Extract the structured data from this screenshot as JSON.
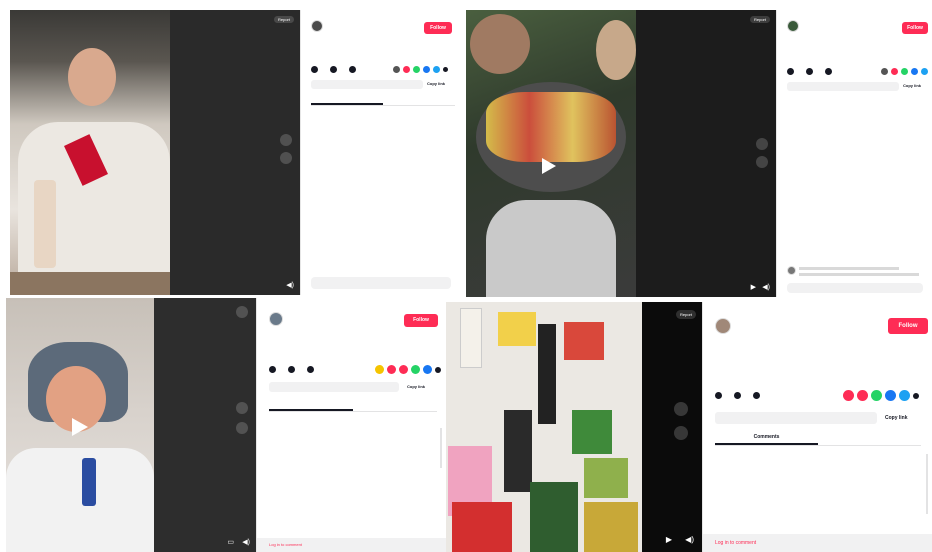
{
  "colors": {
    "accent": "#fe2c55",
    "text": "#161823",
    "muted": "#8a8b91",
    "dark_bg": "#262626"
  },
  "panels": [
    {
      "id": "p1",
      "username": "",
      "meta": "",
      "description": "",
      "music": "",
      "follow_label": "Follow",
      "stats": [
        "",
        "",
        ""
      ],
      "copy_link_label": "Copy link",
      "tabs": [
        "",
        ""
      ],
      "comment_placeholder": "",
      "video_caption": "",
      "report_label": "Report"
    },
    {
      "id": "p2",
      "username": "",
      "meta": "",
      "description": "",
      "music": "",
      "follow_label": "Follow",
      "stats": [
        "",
        "",
        ""
      ],
      "copy_link_label": "Copy link",
      "tabs": [],
      "comment_placeholder": "",
      "video_overlay": "",
      "report_label": "Report"
    },
    {
      "id": "p3",
      "username": "",
      "meta": "",
      "description": "",
      "music": "",
      "follow_label": "Follow",
      "stats": [
        "",
        "",
        ""
      ],
      "copy_link_label": "Copy link",
      "tabs": [
        "",
        ""
      ],
      "comment_placeholder": "Log in to comment"
    },
    {
      "id": "p4",
      "username": "",
      "meta": "",
      "description": "",
      "music": "",
      "follow_label": "Follow",
      "stats": [
        "",
        "",
        ""
      ],
      "copy_link_label": "Copy link",
      "tabs": [
        "Comments",
        ""
      ],
      "comment_placeholder": "Log in to comment",
      "report_label": "Report"
    }
  ]
}
